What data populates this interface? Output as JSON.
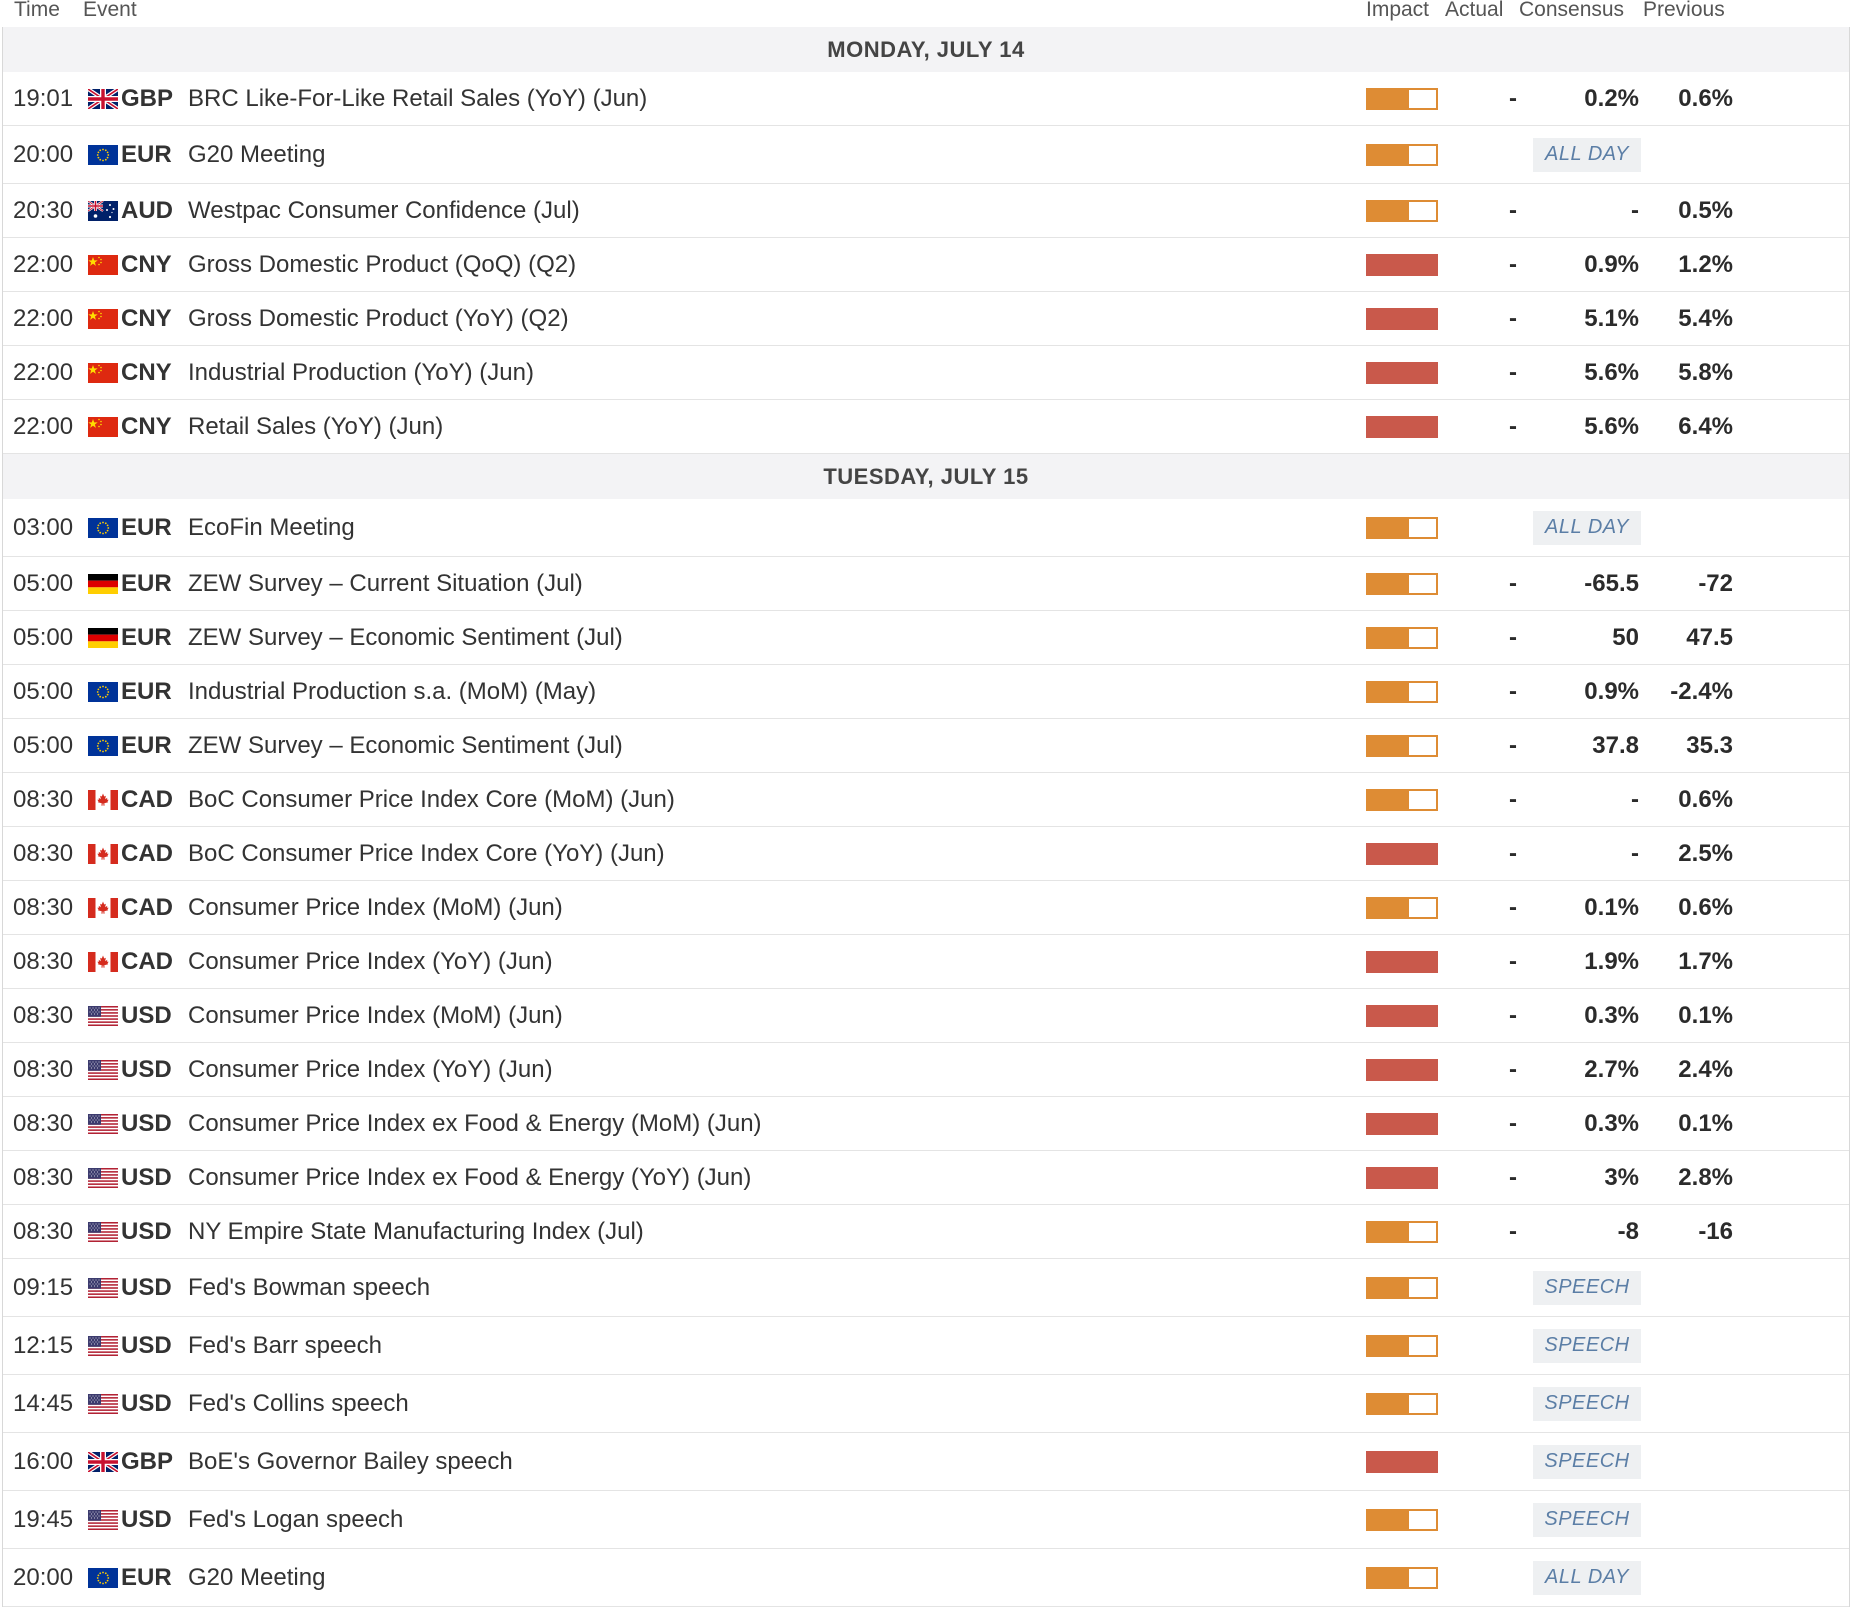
{
  "columns": {
    "time": "Time",
    "event": "Event",
    "impact": "Impact",
    "actual": "Actual",
    "consensus": "Consensus",
    "previous": "Previous"
  },
  "colors": {
    "medium_impact": "#de8c34",
    "high_impact": "#c9594b",
    "tag_text": "#5b7ea6",
    "day_header_bg": "#f3f3f5"
  },
  "days": [
    {
      "label": "MONDAY, JULY 14",
      "events": [
        {
          "time": "19:01",
          "flag": "uk-flag-icon",
          "currency": "GBP",
          "event": "BRC Like-For-Like Retail Sales (YoY) (Jun)",
          "impact": "medium",
          "actual": "-",
          "consensus": "0.2%",
          "previous": "0.6%"
        },
        {
          "time": "20:00",
          "flag": "eu-flag-icon",
          "currency": "EUR",
          "event": "G20 Meeting",
          "impact": "medium",
          "tag": "ALL DAY"
        },
        {
          "time": "20:30",
          "flag": "au-flag-icon",
          "currency": "AUD",
          "event": "Westpac Consumer Confidence (Jul)",
          "impact": "medium",
          "actual": "-",
          "consensus": "-",
          "previous": "0.5%"
        },
        {
          "time": "22:00",
          "flag": "cn-flag-icon",
          "currency": "CNY",
          "event": "Gross Domestic Product (QoQ) (Q2)",
          "impact": "high",
          "actual": "-",
          "consensus": "0.9%",
          "previous": "1.2%"
        },
        {
          "time": "22:00",
          "flag": "cn-flag-icon",
          "currency": "CNY",
          "event": "Gross Domestic Product (YoY) (Q2)",
          "impact": "high",
          "actual": "-",
          "consensus": "5.1%",
          "previous": "5.4%"
        },
        {
          "time": "22:00",
          "flag": "cn-flag-icon",
          "currency": "CNY",
          "event": "Industrial Production (YoY) (Jun)",
          "impact": "high",
          "actual": "-",
          "consensus": "5.6%",
          "previous": "5.8%"
        },
        {
          "time": "22:00",
          "flag": "cn-flag-icon",
          "currency": "CNY",
          "event": "Retail Sales (YoY) (Jun)",
          "impact": "high",
          "actual": "-",
          "consensus": "5.6%",
          "previous": "6.4%"
        }
      ]
    },
    {
      "label": "TUESDAY, JULY 15",
      "events": [
        {
          "time": "03:00",
          "flag": "eu-flag-icon",
          "currency": "EUR",
          "event": "EcoFin Meeting",
          "impact": "medium",
          "tag": "ALL DAY"
        },
        {
          "time": "05:00",
          "flag": "de-flag-icon",
          "currency": "EUR",
          "event": "ZEW Survey – Current Situation (Jul)",
          "impact": "medium",
          "actual": "-",
          "consensus": "-65.5",
          "previous": "-72"
        },
        {
          "time": "05:00",
          "flag": "de-flag-icon",
          "currency": "EUR",
          "event": "ZEW Survey – Economic Sentiment (Jul)",
          "impact": "medium",
          "actual": "-",
          "consensus": "50",
          "previous": "47.5"
        },
        {
          "time": "05:00",
          "flag": "eu-flag-icon",
          "currency": "EUR",
          "event": "Industrial Production s.a. (MoM) (May)",
          "impact": "medium",
          "actual": "-",
          "consensus": "0.9%",
          "previous": "-2.4%"
        },
        {
          "time": "05:00",
          "flag": "eu-flag-icon",
          "currency": "EUR",
          "event": "ZEW Survey – Economic Sentiment (Jul)",
          "impact": "medium",
          "actual": "-",
          "consensus": "37.8",
          "previous": "35.3"
        },
        {
          "time": "08:30",
          "flag": "ca-flag-icon",
          "currency": "CAD",
          "event": "BoC Consumer Price Index Core (MoM) (Jun)",
          "impact": "medium",
          "actual": "-",
          "consensus": "-",
          "previous": "0.6%"
        },
        {
          "time": "08:30",
          "flag": "ca-flag-icon",
          "currency": "CAD",
          "event": "BoC Consumer Price Index Core (YoY) (Jun)",
          "impact": "high",
          "actual": "-",
          "consensus": "-",
          "previous": "2.5%"
        },
        {
          "time": "08:30",
          "flag": "ca-flag-icon",
          "currency": "CAD",
          "event": "Consumer Price Index (MoM) (Jun)",
          "impact": "medium",
          "actual": "-",
          "consensus": "0.1%",
          "previous": "0.6%"
        },
        {
          "time": "08:30",
          "flag": "ca-flag-icon",
          "currency": "CAD",
          "event": "Consumer Price Index (YoY) (Jun)",
          "impact": "high",
          "actual": "-",
          "consensus": "1.9%",
          "previous": "1.7%"
        },
        {
          "time": "08:30",
          "flag": "us-flag-icon",
          "currency": "USD",
          "event": "Consumer Price Index (MoM) (Jun)",
          "impact": "high",
          "actual": "-",
          "consensus": "0.3%",
          "previous": "0.1%"
        },
        {
          "time": "08:30",
          "flag": "us-flag-icon",
          "currency": "USD",
          "event": "Consumer Price Index (YoY) (Jun)",
          "impact": "high",
          "actual": "-",
          "consensus": "2.7%",
          "previous": "2.4%"
        },
        {
          "time": "08:30",
          "flag": "us-flag-icon",
          "currency": "USD",
          "event": "Consumer Price Index ex Food & Energy (MoM) (Jun)",
          "impact": "high",
          "actual": "-",
          "consensus": "0.3%",
          "previous": "0.1%"
        },
        {
          "time": "08:30",
          "flag": "us-flag-icon",
          "currency": "USD",
          "event": "Consumer Price Index ex Food & Energy (YoY) (Jun)",
          "impact": "high",
          "actual": "-",
          "consensus": "3%",
          "previous": "2.8%"
        },
        {
          "time": "08:30",
          "flag": "us-flag-icon",
          "currency": "USD",
          "event": "NY Empire State Manufacturing Index (Jul)",
          "impact": "medium",
          "actual": "-",
          "consensus": "-8",
          "previous": "-16"
        },
        {
          "time": "09:15",
          "flag": "us-flag-icon",
          "currency": "USD",
          "event": "Fed's Bowman speech",
          "impact": "medium",
          "tag": "SPEECH"
        },
        {
          "time": "12:15",
          "flag": "us-flag-icon",
          "currency": "USD",
          "event": "Fed's Barr speech",
          "impact": "medium",
          "tag": "SPEECH"
        },
        {
          "time": "14:45",
          "flag": "us-flag-icon",
          "currency": "USD",
          "event": "Fed's Collins speech",
          "impact": "medium",
          "tag": "SPEECH"
        },
        {
          "time": "16:00",
          "flag": "uk-flag-icon",
          "currency": "GBP",
          "event": "BoE's Governor Bailey speech",
          "impact": "high",
          "tag": "SPEECH"
        },
        {
          "time": "19:45",
          "flag": "us-flag-icon",
          "currency": "USD",
          "event": "Fed's Logan speech",
          "impact": "medium",
          "tag": "SPEECH"
        },
        {
          "time": "20:00",
          "flag": "eu-flag-icon",
          "currency": "EUR",
          "event": "G20 Meeting",
          "impact": "medium",
          "tag": "ALL DAY"
        }
      ]
    }
  ]
}
